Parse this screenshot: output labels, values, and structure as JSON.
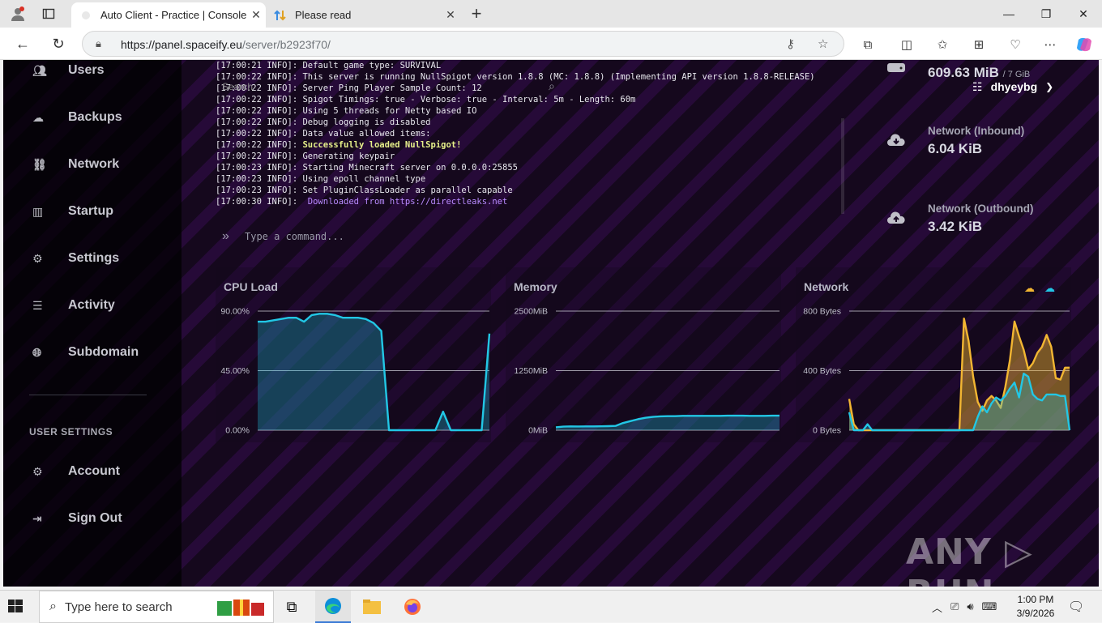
{
  "browser": {
    "tabs": [
      {
        "title": "Auto Client - Practice | Console",
        "active": true,
        "icon": "spaceify-favicon"
      },
      {
        "title": "Please read",
        "active": false,
        "icon": "arrows-favicon"
      }
    ],
    "url_host": "https://panel.spaceify.eu",
    "url_path": "/server/b2923f70/"
  },
  "sidebar": {
    "items": [
      {
        "label": "Users",
        "icon": "users-icon"
      },
      {
        "label": "Backups",
        "icon": "cloud-icon"
      },
      {
        "label": "Network",
        "icon": "network-icon"
      },
      {
        "label": "Startup",
        "icon": "chart-bar-icon"
      },
      {
        "label": "Settings",
        "icon": "cogs-icon"
      },
      {
        "label": "Activity",
        "icon": "list-icon"
      },
      {
        "label": "Subdomain",
        "icon": "globe-icon"
      }
    ],
    "user_heading": "USER SETTINGS",
    "user_items": [
      {
        "label": "Account",
        "icon": "cogs-icon"
      },
      {
        "label": "Sign Out",
        "icon": "sign-out-icon"
      }
    ]
  },
  "console": {
    "lines": [
      {
        "ts": "[17:00:21 INFO]:",
        "msg": "Default game type: SURVIVAL",
        "style": "normal"
      },
      {
        "ts": "[17:00:22 INFO]:",
        "msg": "This server is running NullSpigot version 1.8.8 (MC: 1.8.8) (Implementing API version 1.8.8-RELEASE)",
        "style": "normal"
      },
      {
        "ts": "[17:00:22 INFO]:",
        "msg": "Server Ping Player Sample Count: 12",
        "style": "normal"
      },
      {
        "ts": "[17:00:22 INFO]:",
        "msg": "Spigot Timings: true - Verbose: true - Interval: 5m - Length: 60m",
        "style": "normal"
      },
      {
        "ts": "[17:00:22 INFO]:",
        "msg": "Using 5 threads for Netty based IO",
        "style": "normal"
      },
      {
        "ts": "[17:00:22 INFO]:",
        "msg": "Debug logging is disabled",
        "style": "normal"
      },
      {
        "ts": "[17:00:22 INFO]:",
        "msg": "Data value allowed items:",
        "style": "normal"
      },
      {
        "ts": "[17:00:22 INFO]:",
        "msg": "Successfully loaded NullSpigot!",
        "style": "ok"
      },
      {
        "ts": "[17:00:22 INFO]:",
        "msg": "Generating keypair",
        "style": "normal"
      },
      {
        "ts": "[17:00:23 INFO]:",
        "msg": "Starting Minecraft server on 0.0.0.0:25855",
        "style": "normal"
      },
      {
        "ts": "[17:00:23 INFO]:",
        "msg": "Using epoll channel type",
        "style": "normal"
      },
      {
        "ts": "[17:00:23 INFO]:",
        "msg": "Set PluginClassLoader as parallel capable",
        "style": "normal"
      },
      {
        "ts": "[17:00:30 INFO]:",
        "msg": " Downloaded from https://directleaks.net",
        "style": "link"
      }
    ],
    "overlay_search_label": "Search",
    "command_placeholder": "Type a command...",
    "prompt_glyph": "»"
  },
  "stats": {
    "memory_value": "609.63 MiB",
    "memory_limit": "/ 7 GiB",
    "inbound_label": "Network (Inbound)",
    "inbound_value": "6.04 KiB",
    "outbound_label": "Network (Outbound)",
    "outbound_value": "3.42 KiB"
  },
  "user": {
    "name": "dhyeybg"
  },
  "chart_data": [
    {
      "type": "area",
      "title": "CPU Load",
      "ylim": [
        0,
        90
      ],
      "y_ticks": [
        "90.00%",
        "45.00%",
        "0.00%"
      ],
      "series": [
        {
          "color": "#22c7e5",
          "values": [
            82,
            82,
            83,
            84,
            85,
            85,
            82,
            87,
            88,
            88,
            87,
            85,
            85,
            85,
            84,
            81,
            75,
            0,
            0,
            0,
            0,
            0,
            0,
            0,
            14,
            0,
            0,
            0,
            0,
            0,
            73
          ]
        }
      ]
    },
    {
      "type": "area",
      "title": "Memory",
      "ylim": [
        0,
        2500
      ],
      "y_ticks": [
        "2500MiB",
        "1250MiB",
        "0MiB"
      ],
      "series": [
        {
          "color": "#22c7e5",
          "values": [
            60,
            75,
            80,
            78,
            80,
            80,
            82,
            85,
            90,
            150,
            190,
            230,
            260,
            280,
            290,
            295,
            295,
            300,
            300,
            300,
            300,
            300,
            300,
            305,
            305,
            305,
            300,
            300,
            300,
            305,
            305
          ]
        }
      ]
    },
    {
      "type": "area",
      "title": "Network",
      "ylim": [
        0,
        800
      ],
      "y_ticks": [
        "800 Bytes",
        "400 Bytes",
        "0 Bytes"
      ],
      "series": [
        {
          "color": "#f2b632",
          "values": [
            210,
            40,
            0,
            0,
            0,
            0,
            0,
            0,
            0,
            0,
            0,
            0,
            0,
            0,
            0,
            0,
            0,
            0,
            0,
            0,
            0,
            0,
            0,
            0,
            0,
            750,
            600,
            360,
            190,
            130,
            200,
            230,
            200,
            150,
            290,
            470,
            730,
            630,
            540,
            410,
            450,
            520,
            560,
            640,
            560,
            350,
            340,
            420,
            420
          ]
        },
        {
          "color": "#22c7e5",
          "values": [
            120,
            0,
            0,
            0,
            40,
            0,
            0,
            0,
            0,
            0,
            0,
            0,
            0,
            0,
            0,
            0,
            0,
            0,
            0,
            0,
            0,
            0,
            0,
            0,
            0,
            0,
            0,
            0,
            90,
            160,
            120,
            180,
            220,
            200,
            230,
            280,
            320,
            220,
            380,
            360,
            240,
            210,
            200,
            240,
            240,
            240,
            230,
            230,
            0
          ]
        }
      ]
    }
  ],
  "taskbar": {
    "search_placeholder": "Type here to search",
    "time": "1:00 PM",
    "date": "3/9/2026"
  },
  "watermark": "ANY ▷ RUN"
}
